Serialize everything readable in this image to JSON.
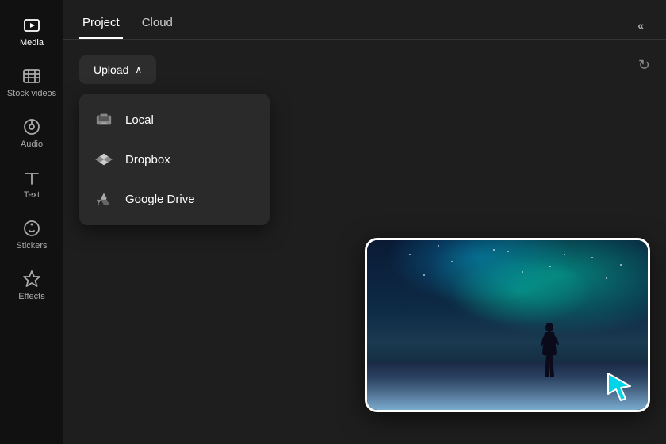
{
  "sidebar": {
    "items": [
      {
        "id": "media",
        "label": "Media",
        "active": true
      },
      {
        "id": "stock-videos",
        "label": "Stock videos",
        "active": false
      },
      {
        "id": "audio",
        "label": "Audio",
        "active": false
      },
      {
        "id": "text",
        "label": "Text",
        "active": false
      },
      {
        "id": "stickers",
        "label": "Stickers",
        "active": false
      },
      {
        "id": "effects",
        "label": "Effects",
        "active": false
      }
    ]
  },
  "tabs": [
    {
      "id": "project",
      "label": "Project",
      "active": true
    },
    {
      "id": "cloud",
      "label": "Cloud",
      "active": false
    }
  ],
  "upload": {
    "button_label": "Upload",
    "chevron": "∧"
  },
  "dropdown": {
    "items": [
      {
        "id": "local",
        "label": "Local"
      },
      {
        "id": "dropbox",
        "label": "Dropbox"
      },
      {
        "id": "google-drive",
        "label": "Google Drive"
      }
    ]
  },
  "collapse_btn_label": "«",
  "refresh_icon": "↻"
}
